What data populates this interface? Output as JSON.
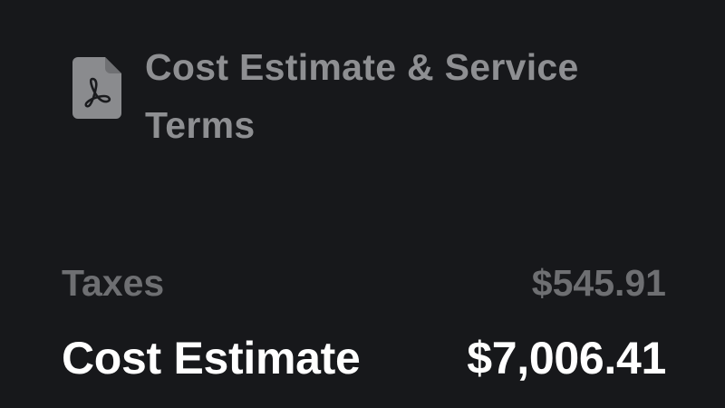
{
  "attachment": {
    "icon": "pdf-document-icon",
    "title": "Cost Estimate & Service Terms"
  },
  "summary": {
    "taxes": {
      "label": "Taxes",
      "value": "$545.91"
    },
    "total": {
      "label": "Cost Estimate",
      "value": "$7,006.41"
    }
  },
  "colors": {
    "background": "#17181b",
    "icon": "#8a8b8e",
    "muted_text": "#6e6f72",
    "title_text": "#8e8f92",
    "total_text": "#ffffff"
  }
}
